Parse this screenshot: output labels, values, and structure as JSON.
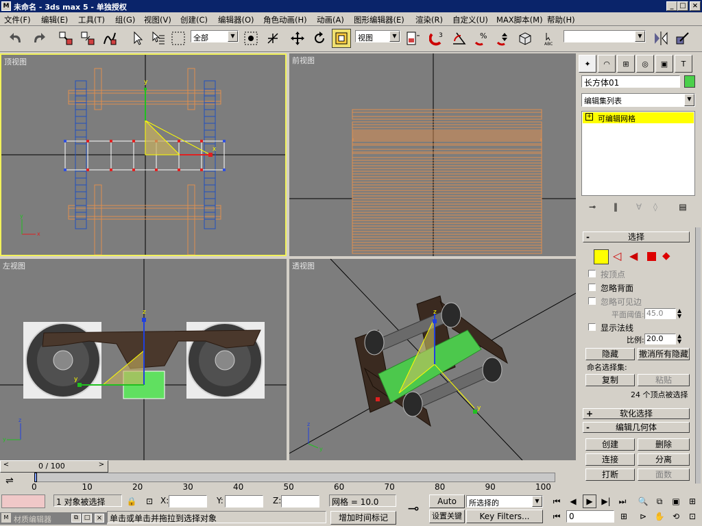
{
  "window": {
    "title": "未命名 - 3ds max 5 - 单独授权",
    "min": "_",
    "max": "□",
    "close": "×"
  },
  "menu": [
    "文件(F)",
    "编辑(E)",
    "工具(T)",
    "组(G)",
    "视图(V)",
    "创建(C)",
    "编辑器(O)",
    "角色动画(H)",
    "动画(A)",
    "图形编辑器(E)",
    "渲染(R)",
    "自定义(U)",
    "MAX脚本(M)",
    "帮助(H)"
  ],
  "toolbar": {
    "selection_filter": "全部",
    "ref_coord": "视图",
    "named_selection": "",
    "abc": "ABC"
  },
  "viewports": {
    "top": "顶视图",
    "front": "前视图",
    "left": "左视图",
    "persp": "透视图"
  },
  "axes": {
    "x": "x",
    "y": "y",
    "z": "z"
  },
  "command_panel": {
    "object_name": "长方体01",
    "object_color": "#4bd04b",
    "modifier_list": "编辑集列表",
    "stack_item": "可编辑网格",
    "stack_item_sign": "+",
    "rollouts": {
      "select": {
        "title": "选择",
        "sign": "-",
        "by_vertex": "按顶点",
        "ignore_backfacing": "忽略背面",
        "ignore_visible_edges": "忽略可见边",
        "planar_thresh_label": "平面阈值:",
        "planar_thresh": "45.0",
        "show_normals": "显示法线",
        "scale_label": "比例:",
        "scale": "20.0",
        "hide": "隐藏",
        "unhide_all": "撤消所有隐藏",
        "named_sel_label": "命名选择集:",
        "copy": "复制",
        "paste": "粘贴",
        "status": "24 个顶点被选择"
      },
      "soft_select": {
        "title": "软化选择",
        "sign": "+"
      },
      "edit_geometry": {
        "title": "编辑几何体",
        "sign": "-",
        "create": "创建",
        "delete": "删除",
        "attach": "连接",
        "detach": "分离",
        "break": "打断",
        "turn": "面数"
      }
    }
  },
  "timeline": {
    "counter": "0 / 100",
    "prev": "<",
    "next": ">",
    "ticks": [
      "0",
      "10",
      "20",
      "30",
      "40",
      "50",
      "60",
      "70",
      "80",
      "90",
      "100"
    ]
  },
  "statusbar": {
    "selected": "1 对象被选择",
    "x_label": "X:",
    "y_label": "Y:",
    "z_label": "Z:",
    "x": "",
    "y": "",
    "z": "",
    "grid": "网格 = 10.0",
    "prompt": "单击或单击并拖拉到选择对象",
    "add_time_tag": "增加时间标记",
    "auto_key": "Auto Key",
    "selected_dd": "所选择的",
    "set_key": "设置关键帧",
    "key_filters": "Key Filters...",
    "frame": "0",
    "mat_editor": "材质编辑器"
  },
  "colors": {
    "viewport_bg": "#7d7d7d",
    "active_border": "#f2f25a",
    "accent_yellow": "#ffff00",
    "title_blue": "#0a246a"
  }
}
